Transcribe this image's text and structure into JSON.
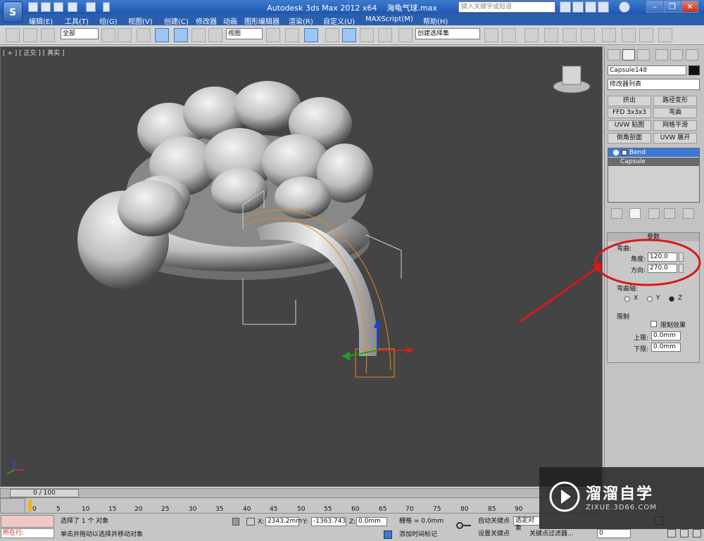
{
  "window": {
    "title": "Autodesk 3ds Max  2012 x64",
    "filename": "海龟气球.max",
    "search_placeholder": "键入关键字或短语"
  },
  "menus": [
    "编辑(E)",
    "工具(T)",
    "组(G)",
    "视图(V)",
    "创建(C)",
    "修改器",
    "动画",
    "图形编辑器",
    "渲染(R)",
    "自定义(U)",
    "MAXScript(M)",
    "帮助(H)"
  ],
  "toolbar": {
    "selection_filter": "全部",
    "ref_coord": "视图",
    "named_selection": "创建选择集"
  },
  "viewport": {
    "label": "[ + ] [ 正交 ] [ 真实 ]"
  },
  "command_panel": {
    "object_name": "Capsule148",
    "modifier_list": "修改器列表",
    "modifier_buttons": [
      "挤出",
      "路径变形",
      "FFD 3x3x3",
      "弯曲",
      "UVW 贴图",
      "网格平滑",
      "倒角剖面",
      "UVW 展开"
    ],
    "stack": [
      "Bend",
      "Capsule"
    ],
    "params_title": "参数",
    "bend_group": "弯曲:",
    "angle_label": "角度:",
    "angle_value": "120.0",
    "direction_label": "方向:",
    "direction_value": "270.0",
    "axis_group": "弯曲轴:",
    "axes": [
      "X",
      "Y",
      "Z"
    ],
    "selected_axis": "Z",
    "limits_group": "限制",
    "limit_effect": "限制效果",
    "upper_label": "上限:",
    "upper_value": "0.0mm",
    "lower_label": "下限:",
    "lower_value": "0.0mm"
  },
  "timeline": {
    "frame": "0 / 100",
    "ticks": [
      "0",
      "5",
      "10",
      "15",
      "20",
      "25",
      "30",
      "35",
      "40",
      "45",
      "50",
      "55",
      "60",
      "65",
      "70",
      "75",
      "80",
      "85",
      "90"
    ]
  },
  "status": {
    "running": "所在行:",
    "selected": "选择了 1 个 对象",
    "prompt": "单击并拖动以选择并移动对象",
    "x_label": "X:",
    "x_value": "2343.2mm",
    "y_label": "Y:",
    "y_value": "-1363.743",
    "z_label": "Z:",
    "z_value": "0.0mm",
    "grid": "栅格 = 0.0mm",
    "add_time_tag": "添加时间标记",
    "auto_key": "自动关键点",
    "selected_obj": "选定对象",
    "set_key": "设置关键点",
    "key_filters": "关键点过滤器...",
    "frame_value": "0"
  },
  "watermark": {
    "brand": "溜溜自学",
    "url": "ZIXUE.3D66.COM"
  },
  "colors": {
    "viewport_bg": "#444444",
    "menu_bg": "#2a5fb0",
    "selection_orange": "#e08a1e",
    "annotation_red": "#d81818"
  }
}
